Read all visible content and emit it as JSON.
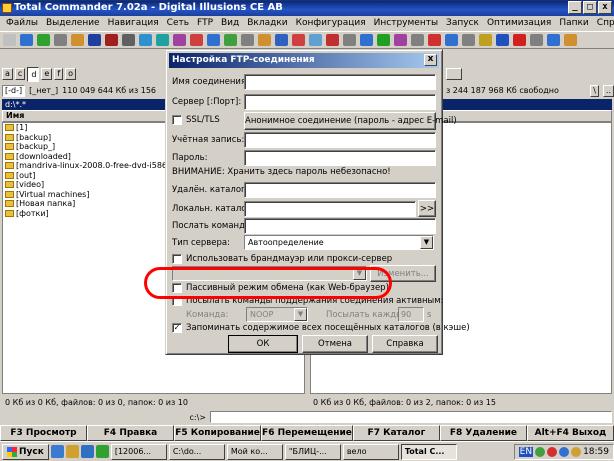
{
  "window": {
    "title": "Total Commander 7.02a - Digital Illusions CE AB",
    "buttons": [
      "_",
      "□",
      "x"
    ]
  },
  "menu": {
    "items": [
      "Файлы",
      "Выделение",
      "Навигация",
      "Сеть",
      "FTP",
      "Вид",
      "Вкладки",
      "Конфигурация",
      "Инструменты",
      "Запуск",
      "Оптимизация"
    ],
    "right": [
      "Папки",
      "Справка"
    ]
  },
  "toolbar_icons": [
    "#c0c0c0",
    "#3070d0",
    "#30a030",
    "#808080",
    "#d09030",
    "#2040a0",
    "#a02020",
    "#606060",
    "#3090d0",
    "#20a0a0",
    "#a040a0",
    "#d04040",
    "#3070d0",
    "#40a040",
    "#808080",
    "#d09030",
    "#3060c0",
    "#d04040",
    "#60a0d0",
    "#c03030",
    "#808080",
    "#3070d0",
    "#20a020",
    "#a040a0",
    "#808080",
    "#d03030",
    "#3070d0",
    "#808080",
    "#c0a020",
    "#2050c0",
    "#d02020",
    "#808080",
    "#3070d0",
    "#d09030"
  ],
  "left_panel": {
    "drives": [
      "a",
      "c",
      "d",
      "e",
      "f",
      "o"
    ],
    "selected_drive": "d",
    "drive_select": "[-d-]",
    "volume": "[_нет_]",
    "space": "110 049 644 Кб из 156",
    "path": "d:\\*.*",
    "column_name": "Имя",
    "files": [
      "[1]",
      "[backup]",
      "[backup_]",
      "[downloaded]",
      "[mandriva-linux-2008.0-free-dvd-i586",
      "[out]",
      "[video]",
      "[Virtual machines]",
      "[Новая папка]",
      "[фотки]"
    ],
    "status": "0 Кб из 0 Кб, файлов: 0 из 0, папок: 0 из 10"
  },
  "right_panel": {
    "space": "з 244 187 968 Кб свободно",
    "nav": [
      "\\",
      ".."
    ],
    "status": "0 Кб из 0 Кб, файлов: 0 из 2, папок: 0 из 15"
  },
  "cmdline": {
    "label": "c:\\>"
  },
  "fkeys": [
    "F3 Просмотр",
    "F4 Правка",
    "F5 Копирование",
    "F6 Перемещение",
    "F7 Каталог",
    "F8 Удаление",
    "Alt+F4 Выход"
  ],
  "taskbar": {
    "start": "Пуск",
    "tasks": [
      "[12006...",
      "C:\\do...",
      "Мой ко...",
      "\"БЛИЦ-...",
      "вело",
      "Total C..."
    ],
    "active_task": "Total C...",
    "lang": "EN",
    "clock": "18:59"
  },
  "dialog": {
    "title": "Настройка FTP-соединения",
    "close": "x",
    "fields": {
      "connection_name": "Имя соединения:",
      "server_port": "Сервер [:Порт]:",
      "account": "Учётная запись:",
      "password": "Пароль:",
      "remote_dir": "Удалён. каталог:",
      "local_dir": "Локальн. каталог:",
      "send_commands": "Послать команды:"
    },
    "ssl_label": "SSL/TLS",
    "anon_button": "Анонимное соединение (пароль - адрес E-mail)",
    "warning": "ВНИМАНИЕ: Хранить здесь пароль небезопасно!",
    "browse_button": ">>",
    "server_type_label": "Тип сервера:",
    "server_type_value": "Автоопределение",
    "firewall_label": "Использовать брандмауэр или прокси-сервер",
    "change_button": "Изменить...",
    "passive_label": "Пассивный режим обмена (как Web-браузер)",
    "keepalive_label": "Посылать команды поддержания соединения активным:",
    "command_label": "Команда:",
    "command_value": "NOOP",
    "send_every_label": "Посылать каждые:",
    "send_every_value": "90",
    "send_every_unit": "s",
    "remember_label": "Запоминать содержимое всех посещённых каталогов (в кэше)",
    "remember_checked": "✓",
    "ok": "ОК",
    "cancel": "Отмена",
    "help": "Справка"
  },
  "colors": {
    "annotation": "#ff0000",
    "title_blue": "#0a246a"
  }
}
